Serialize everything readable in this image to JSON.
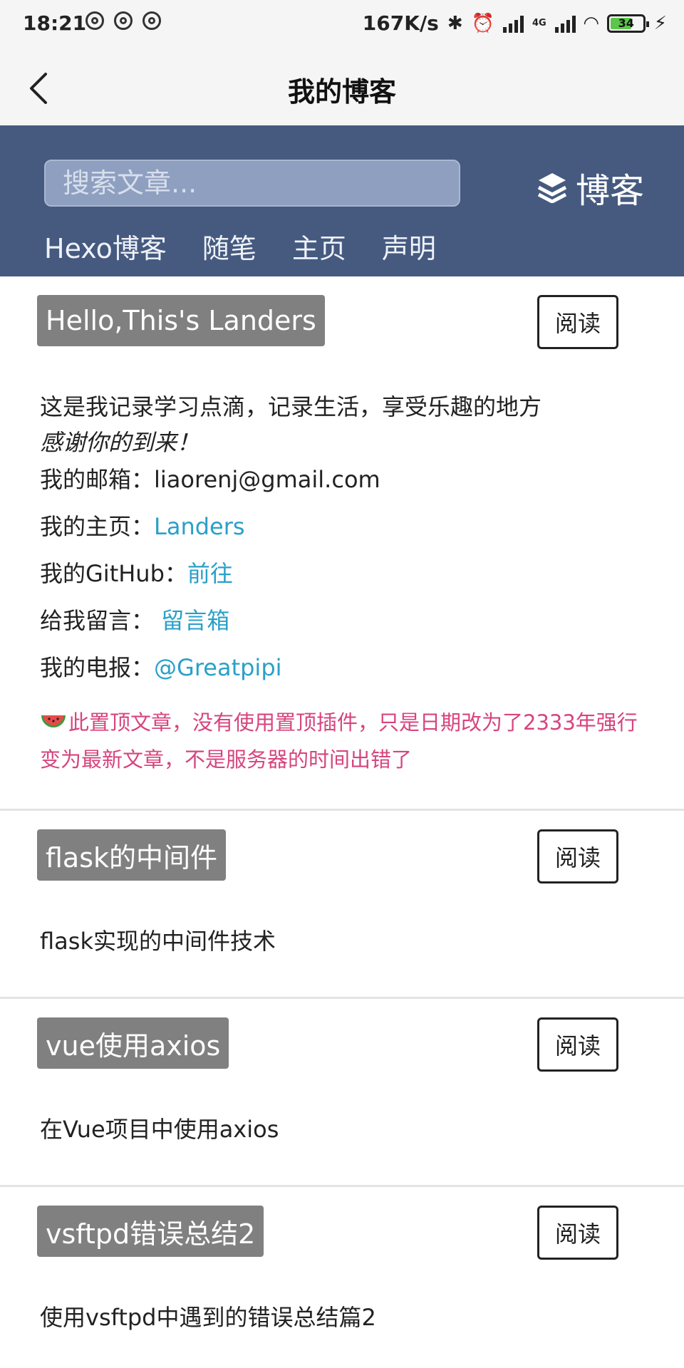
{
  "status_bar": {
    "time": "18:21",
    "speed": "167K/s",
    "network_label": "4G",
    "battery": "34"
  },
  "title_bar": {
    "title": "我的博客"
  },
  "blog_header": {
    "search_placeholder": "搜索文章...",
    "brand": "博客",
    "nav": [
      "Hexo博客",
      "随笔",
      "主页",
      "声明"
    ]
  },
  "read_label": "阅读",
  "pinned_post": {
    "title": "Hello,This's Landers",
    "intro": "这是我记录学习点滴，记录生活，享受乐趣的地方",
    "thanks": "感谢你的到来！",
    "email_label": "我的邮箱：",
    "email": "liaorenj@gmail.com",
    "home_label": "我的主页：",
    "home_link": "Landers",
    "github_label": "我的GitHub：",
    "github_link": "前往",
    "message_label": "给我留言：",
    "message_link": "留言箱",
    "telegram_label": "我的电报：",
    "telegram_link": "@Greatpipi",
    "notice": "此置顶文章，没有使用置顶插件，只是日期改为了2333年强行变为最新文章，不是服务器的时间出错了"
  },
  "posts": [
    {
      "title": "flask的中间件",
      "summary": "flask实现的中间件技术"
    },
    {
      "title": "vue使用axios",
      "summary": "在Vue项目中使用axios"
    },
    {
      "title": "vsftpd错误总结2",
      "summary": "使用vsftpd中遇到的错误总结篇2"
    }
  ],
  "colors": {
    "header_bg": "#465a80",
    "link": "#2aa0c8",
    "notice": "#d6457e",
    "title_tag_bg": "#808080"
  }
}
